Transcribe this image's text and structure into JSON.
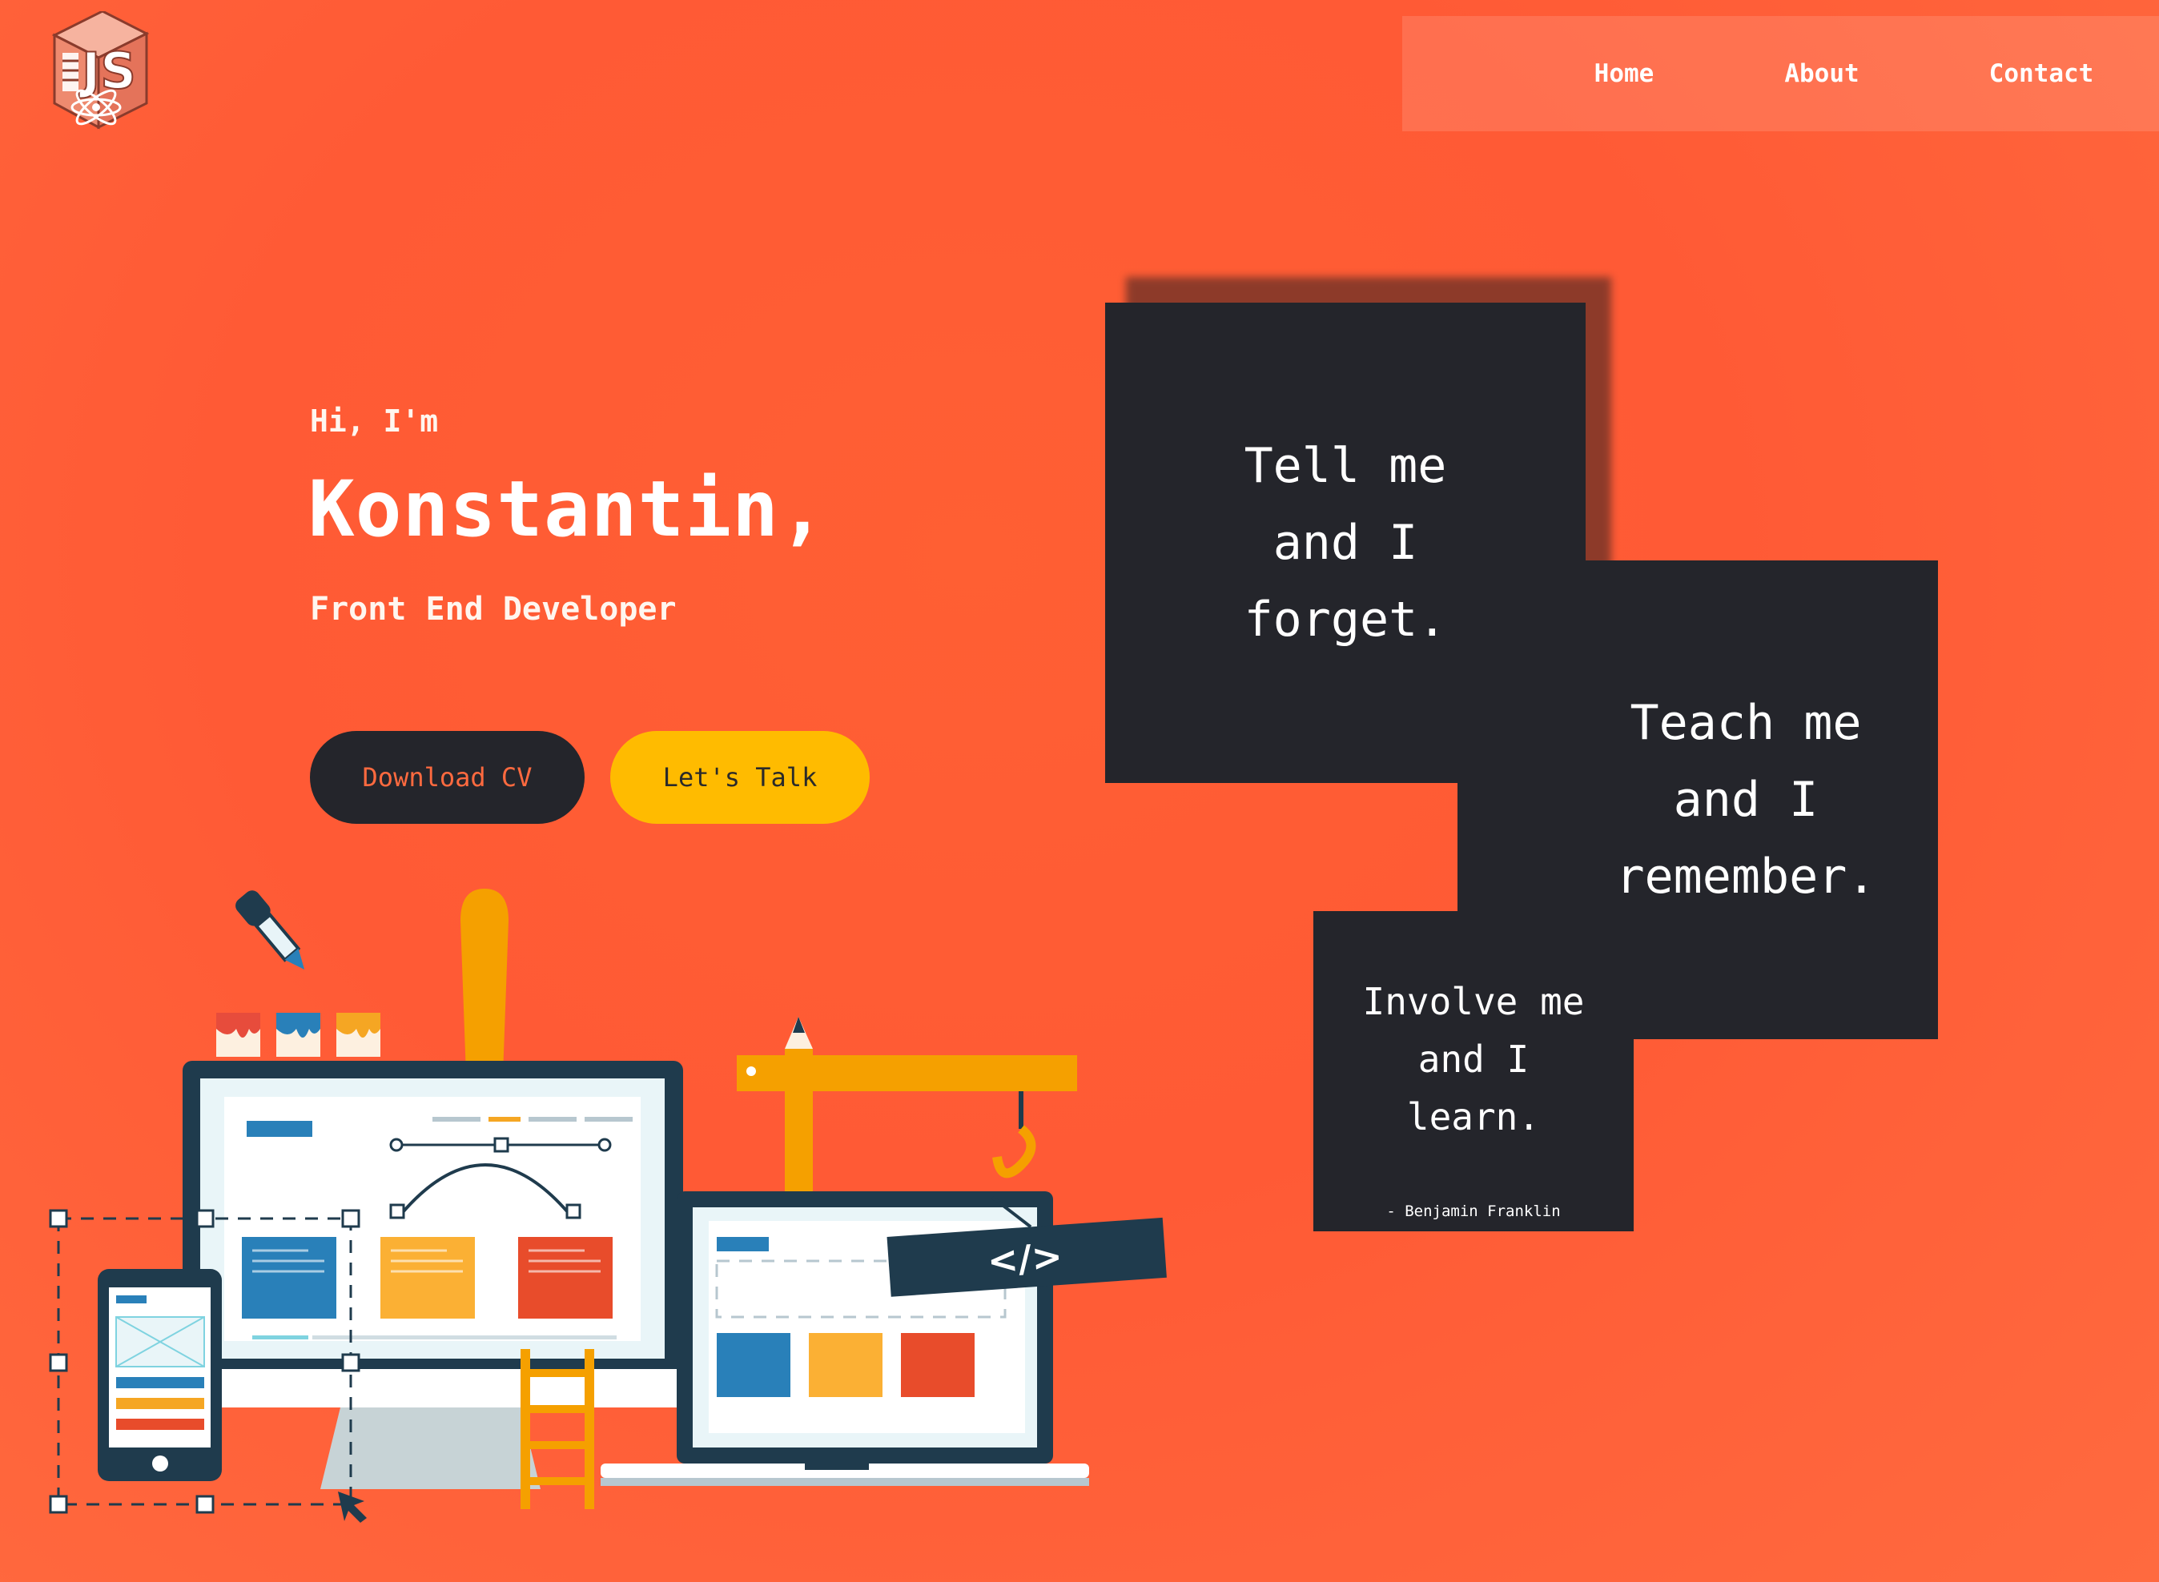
{
  "logo": {
    "text": "JS",
    "icon": "js-cube-logo"
  },
  "nav": {
    "items": [
      {
        "label": "Home"
      },
      {
        "label": "About"
      },
      {
        "label": "Contact"
      }
    ]
  },
  "hero": {
    "greeting": "Hi, I'm",
    "name": "Konstantin,",
    "role": "Front End Developer",
    "buttons": {
      "download_cv": "Download CV",
      "lets_talk": "Let's Talk"
    }
  },
  "illustration": {
    "icon": "web-design-devices-illustration",
    "code_sign": "</>"
  },
  "quotes": [
    {
      "text": "Tell me\nand I\nforget."
    },
    {
      "text": "Teach me\nand I\nremember."
    },
    {
      "text": "Involve me\nand I\nlearn."
    }
  ],
  "quote_author": "- Benjamin Franklin",
  "colors": {
    "background": "#ff5a35",
    "dark": "#24252b",
    "accent_yellow": "#ffbb00",
    "accent_orange": "#ff6a3f"
  }
}
